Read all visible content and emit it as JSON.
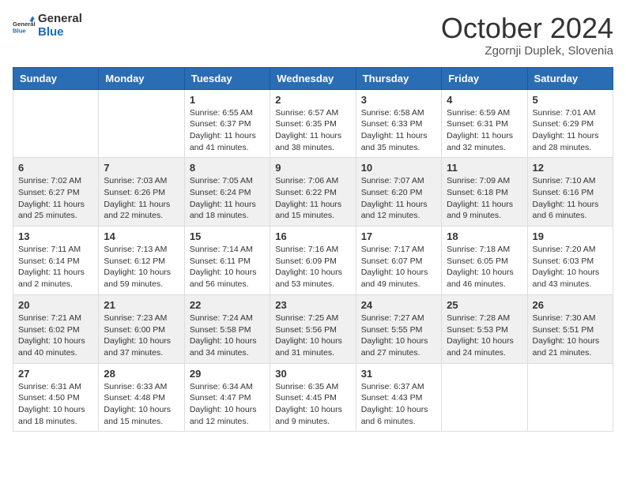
{
  "header": {
    "logo_line1": "General",
    "logo_line2": "Blue",
    "month": "October 2024",
    "location": "Zgornji Duplek, Slovenia"
  },
  "weekdays": [
    "Sunday",
    "Monday",
    "Tuesday",
    "Wednesday",
    "Thursday",
    "Friday",
    "Saturday"
  ],
  "weeks": [
    [
      {
        "day": "",
        "info": ""
      },
      {
        "day": "",
        "info": ""
      },
      {
        "day": "1",
        "info": "Sunrise: 6:55 AM\nSunset: 6:37 PM\nDaylight: 11 hours and 41 minutes."
      },
      {
        "day": "2",
        "info": "Sunrise: 6:57 AM\nSunset: 6:35 PM\nDaylight: 11 hours and 38 minutes."
      },
      {
        "day": "3",
        "info": "Sunrise: 6:58 AM\nSunset: 6:33 PM\nDaylight: 11 hours and 35 minutes."
      },
      {
        "day": "4",
        "info": "Sunrise: 6:59 AM\nSunset: 6:31 PM\nDaylight: 11 hours and 32 minutes."
      },
      {
        "day": "5",
        "info": "Sunrise: 7:01 AM\nSunset: 6:29 PM\nDaylight: 11 hours and 28 minutes."
      }
    ],
    [
      {
        "day": "6",
        "info": "Sunrise: 7:02 AM\nSunset: 6:27 PM\nDaylight: 11 hours and 25 minutes."
      },
      {
        "day": "7",
        "info": "Sunrise: 7:03 AM\nSunset: 6:26 PM\nDaylight: 11 hours and 22 minutes."
      },
      {
        "day": "8",
        "info": "Sunrise: 7:05 AM\nSunset: 6:24 PM\nDaylight: 11 hours and 18 minutes."
      },
      {
        "day": "9",
        "info": "Sunrise: 7:06 AM\nSunset: 6:22 PM\nDaylight: 11 hours and 15 minutes."
      },
      {
        "day": "10",
        "info": "Sunrise: 7:07 AM\nSunset: 6:20 PM\nDaylight: 11 hours and 12 minutes."
      },
      {
        "day": "11",
        "info": "Sunrise: 7:09 AM\nSunset: 6:18 PM\nDaylight: 11 hours and 9 minutes."
      },
      {
        "day": "12",
        "info": "Sunrise: 7:10 AM\nSunset: 6:16 PM\nDaylight: 11 hours and 6 minutes."
      }
    ],
    [
      {
        "day": "13",
        "info": "Sunrise: 7:11 AM\nSunset: 6:14 PM\nDaylight: 11 hours and 2 minutes."
      },
      {
        "day": "14",
        "info": "Sunrise: 7:13 AM\nSunset: 6:12 PM\nDaylight: 10 hours and 59 minutes."
      },
      {
        "day": "15",
        "info": "Sunrise: 7:14 AM\nSunset: 6:11 PM\nDaylight: 10 hours and 56 minutes."
      },
      {
        "day": "16",
        "info": "Sunrise: 7:16 AM\nSunset: 6:09 PM\nDaylight: 10 hours and 53 minutes."
      },
      {
        "day": "17",
        "info": "Sunrise: 7:17 AM\nSunset: 6:07 PM\nDaylight: 10 hours and 49 minutes."
      },
      {
        "day": "18",
        "info": "Sunrise: 7:18 AM\nSunset: 6:05 PM\nDaylight: 10 hours and 46 minutes."
      },
      {
        "day": "19",
        "info": "Sunrise: 7:20 AM\nSunset: 6:03 PM\nDaylight: 10 hours and 43 minutes."
      }
    ],
    [
      {
        "day": "20",
        "info": "Sunrise: 7:21 AM\nSunset: 6:02 PM\nDaylight: 10 hours and 40 minutes."
      },
      {
        "day": "21",
        "info": "Sunrise: 7:23 AM\nSunset: 6:00 PM\nDaylight: 10 hours and 37 minutes."
      },
      {
        "day": "22",
        "info": "Sunrise: 7:24 AM\nSunset: 5:58 PM\nDaylight: 10 hours and 34 minutes."
      },
      {
        "day": "23",
        "info": "Sunrise: 7:25 AM\nSunset: 5:56 PM\nDaylight: 10 hours and 31 minutes."
      },
      {
        "day": "24",
        "info": "Sunrise: 7:27 AM\nSunset: 5:55 PM\nDaylight: 10 hours and 27 minutes."
      },
      {
        "day": "25",
        "info": "Sunrise: 7:28 AM\nSunset: 5:53 PM\nDaylight: 10 hours and 24 minutes."
      },
      {
        "day": "26",
        "info": "Sunrise: 7:30 AM\nSunset: 5:51 PM\nDaylight: 10 hours and 21 minutes."
      }
    ],
    [
      {
        "day": "27",
        "info": "Sunrise: 6:31 AM\nSunset: 4:50 PM\nDaylight: 10 hours and 18 minutes."
      },
      {
        "day": "28",
        "info": "Sunrise: 6:33 AM\nSunset: 4:48 PM\nDaylight: 10 hours and 15 minutes."
      },
      {
        "day": "29",
        "info": "Sunrise: 6:34 AM\nSunset: 4:47 PM\nDaylight: 10 hours and 12 minutes."
      },
      {
        "day": "30",
        "info": "Sunrise: 6:35 AM\nSunset: 4:45 PM\nDaylight: 10 hours and 9 minutes."
      },
      {
        "day": "31",
        "info": "Sunrise: 6:37 AM\nSunset: 4:43 PM\nDaylight: 10 hours and 6 minutes."
      },
      {
        "day": "",
        "info": ""
      },
      {
        "day": "",
        "info": ""
      }
    ]
  ]
}
